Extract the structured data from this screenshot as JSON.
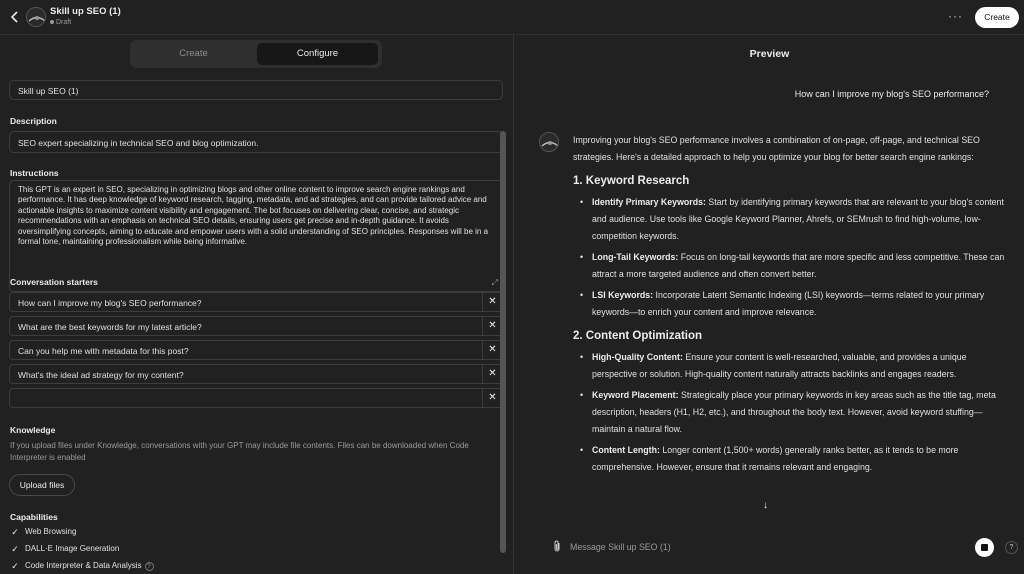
{
  "topbar": {
    "title": "Skill up SEO (1)",
    "status": "Draft",
    "more_label": "···",
    "create_label": "Create"
  },
  "tabs": [
    {
      "label": "Create",
      "active": false
    },
    {
      "label": "Configure",
      "active": true
    }
  ],
  "config": {
    "name_value": "Skill up SEO (1)",
    "description_label": "Description",
    "description_value": "SEO expert specializing in technical SEO and blog optimization.",
    "instructions_label": "Instructions",
    "instructions_value": "This GPT is an expert in SEO, specializing in optimizing blogs and other online content to improve search engine rankings and performance. It has deep knowledge of keyword research, tagging, metadata, and ad strategies, and can provide tailored advice and actionable insights to maximize content visibility and engagement. The bot focuses on delivering clear, concise, and strategic recommendations with an emphasis on technical SEO details, ensuring users get precise and in-depth guidance. It avoids oversimplifying concepts, aiming to educate and empower users with a solid understanding of SEO principles. Responses will be in a formal tone, maintaining professionalism while being informative.",
    "starters_label": "Conversation starters",
    "starters": [
      "How can I improve my blog's SEO performance?",
      "What are the best keywords for my latest article?",
      "Can you help me with metadata for this post?",
      "What's the ideal ad strategy for my content?",
      ""
    ],
    "knowledge_label": "Knowledge",
    "knowledge_text": "If you upload files under Knowledge, conversations with your GPT may include file contents. Files can be downloaded when Code Interpreter is enabled",
    "upload_label": "Upload files",
    "capabilities_label": "Capabilities",
    "capabilities": [
      {
        "label": "Web Browsing",
        "checked": true
      },
      {
        "label": "DALL·E Image Generation",
        "checked": true
      },
      {
        "label": "Code Interpreter & Data Analysis",
        "checked": true
      }
    ]
  },
  "preview": {
    "title": "Preview",
    "user_message": "How can I improve my blog's SEO performance?",
    "intro": "Improving your blog's SEO performance involves a combination of on-page, off-page, and technical SEO strategies. Here's a detailed approach to help you optimize your blog for better search engine rankings:",
    "sections": [
      {
        "heading": "1. Keyword Research",
        "items": [
          {
            "term": "Identify Primary Keywords:",
            "text": " Start by identifying primary keywords that are relevant to your blog's content and audience. Use tools like Google Keyword Planner, Ahrefs, or SEMrush to find high-volume, low-competition keywords."
          },
          {
            "term": "Long-Tail Keywords:",
            "text": " Focus on long-tail keywords that are more specific and less competitive. These can attract a more targeted audience and often convert better."
          },
          {
            "term": "LSI Keywords:",
            "text": " Incorporate Latent Semantic Indexing (LSI) keywords—terms related to your primary keywords—to enrich your content and improve relevance."
          }
        ]
      },
      {
        "heading": "2. Content Optimization",
        "items": [
          {
            "term": "High-Quality Content:",
            "text": " Ensure your content is well-researched, valuable, and provides a unique perspective or solution. High-quality content naturally attracts backlinks and engages readers."
          },
          {
            "term": "Keyword Placement:",
            "text": " Strategically place your primary keywords in key areas such as the title tag, meta description, headers (H1, H2, etc.), and throughout the body text. However, avoid keyword stuffing—maintain a natural flow."
          },
          {
            "term": "Content Length:",
            "text": " Longer content (1,500+ words) generally ranks better, as it tends to be more comprehensive. However, ensure that it remains relevant and engaging."
          }
        ]
      }
    ],
    "composer_placeholder": "Message Skill up SEO (1)",
    "help_label": "?"
  }
}
